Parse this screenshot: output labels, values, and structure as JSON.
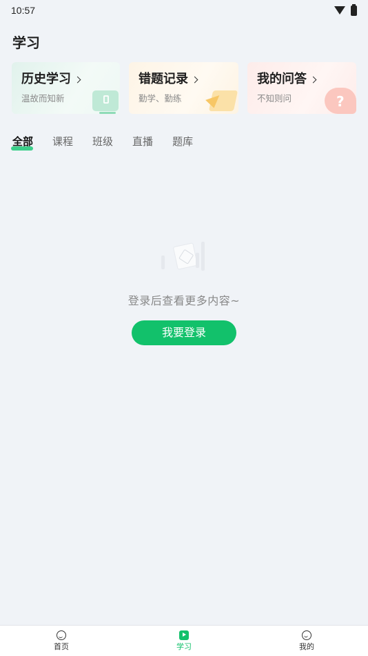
{
  "status_bar": {
    "time": "10:57"
  },
  "header": {
    "title": "学习"
  },
  "cards": [
    {
      "title": "历史学习",
      "subtitle": "温故而知新"
    },
    {
      "title": "错题记录",
      "subtitle": "勤学、勤练"
    },
    {
      "title": "我的问答",
      "subtitle": "不知则问"
    }
  ],
  "tabs": [
    "全部",
    "课程",
    "班级",
    "直播",
    "题库"
  ],
  "active_tab": "全部",
  "empty_state": {
    "message": "登录后查看更多内容~",
    "button_label": "我要登录"
  },
  "bottom_nav": [
    {
      "label": "首页",
      "icon": "home-icon"
    },
    {
      "label": "学习",
      "icon": "study-icon",
      "active": true
    },
    {
      "label": "我的",
      "icon": "profile-icon"
    }
  ],
  "colors": {
    "accent": "#12c16b",
    "background": "#f0f3f7"
  }
}
